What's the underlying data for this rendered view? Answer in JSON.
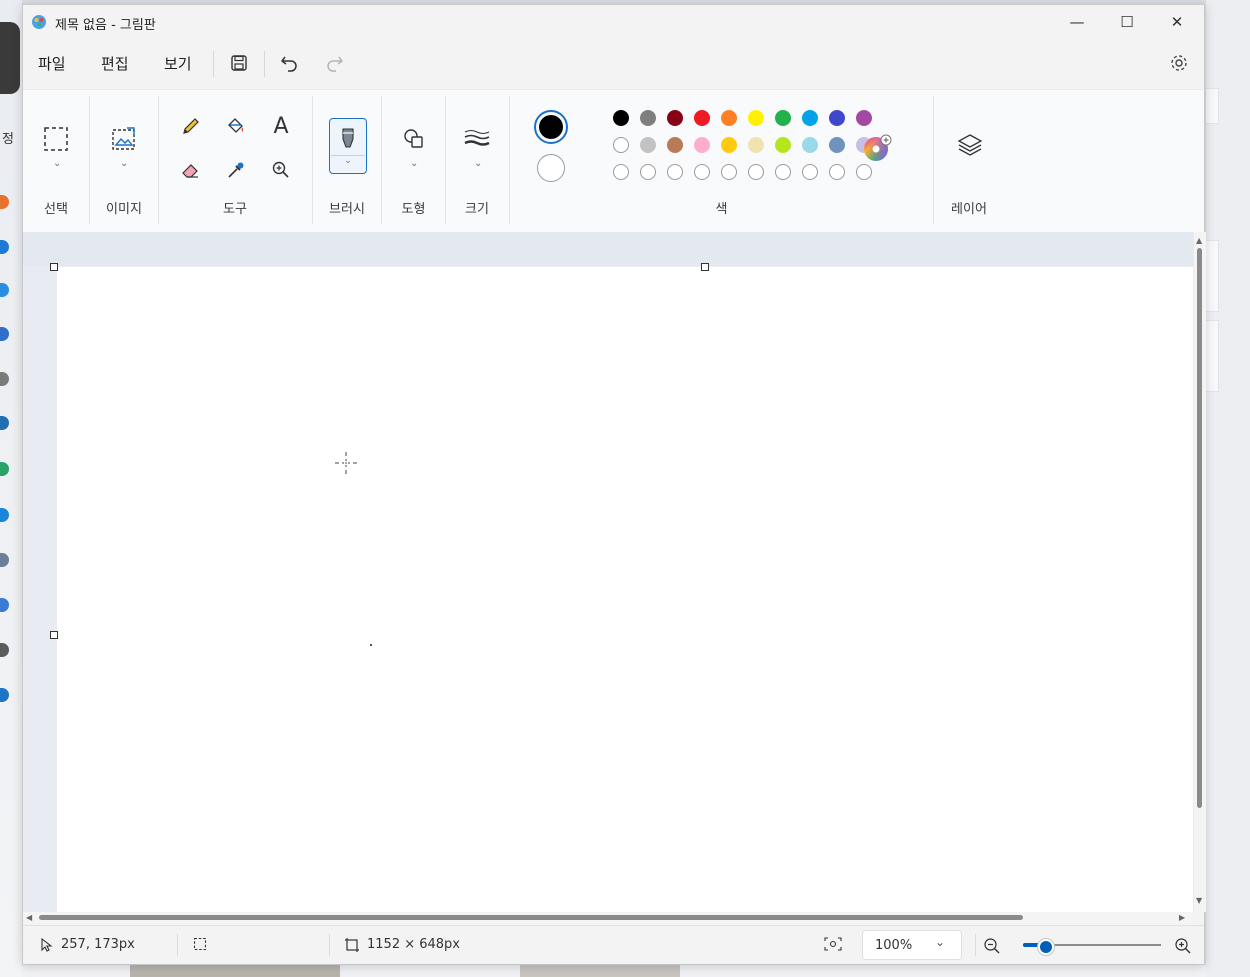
{
  "window": {
    "title": "제목 없음 - 그림판",
    "minimize_glyph": "—",
    "maximize_glyph": "☐",
    "close_glyph": "✕"
  },
  "menu": {
    "file": "파일",
    "edit": "편집",
    "view": "보기"
  },
  "ribbon": {
    "select_label": "선택",
    "image_label": "이미지",
    "tools_label": "도구",
    "brush_label": "브러시",
    "shapes_label": "도형",
    "size_label": "크기",
    "colors_label": "색",
    "layers_label": "레이어",
    "text_tool_glyph": "A",
    "primary_color": "#000000",
    "secondary_color": "#ffffff",
    "palette_row1": [
      "#000000",
      "#7f7f7f",
      "#880015",
      "#ed1c24",
      "#ff7f27",
      "#fff200",
      "#22b14c",
      "#00a2e8",
      "#3f48cc",
      "#a349a4"
    ],
    "palette_row2": [
      "#ffffff",
      "#c3c3c3",
      "#b97a57",
      "#ffaec9",
      "#ffc90e",
      "#efe4b0",
      "#b5e61d",
      "#99d9ea",
      "#7092be",
      "#c8bfe7"
    ],
    "custom_slots": 10
  },
  "desktop": {
    "side_label": "정"
  },
  "status": {
    "cursor_position": "257, 173px",
    "canvas_size": "1152 × 648px",
    "zoom": "100%",
    "zoom_fraction": 0.17
  }
}
